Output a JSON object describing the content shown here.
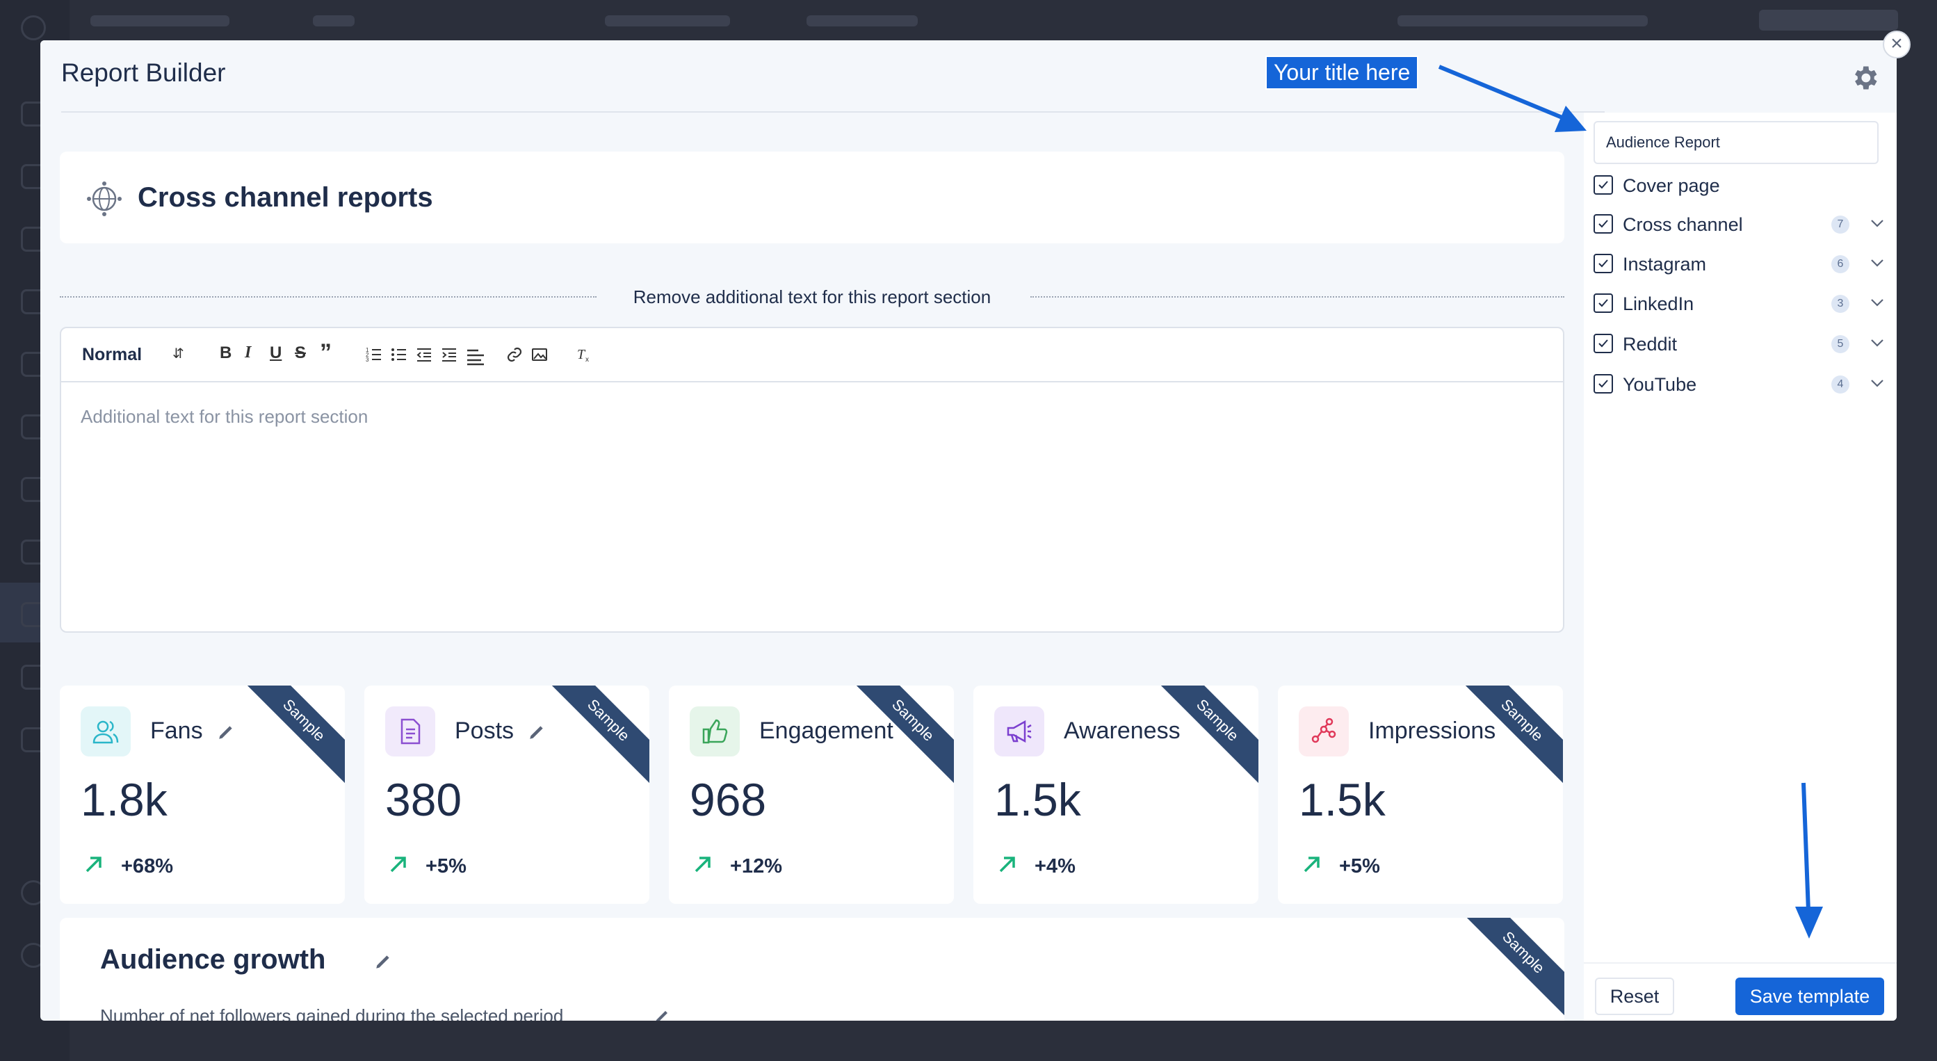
{
  "modal": {
    "title": "Report Builder",
    "close_label": "×"
  },
  "callout": {
    "text": "Your title here"
  },
  "section": {
    "title": "Cross channel reports",
    "divider_text": "Remove additional text for this report section"
  },
  "editor": {
    "format_select": "Normal",
    "toolbar": [
      "B",
      "I",
      "U",
      "S",
      "”"
    ],
    "placeholder": "Additional text for this report section"
  },
  "cards": [
    {
      "label": "Fans",
      "value": "1.8k",
      "change": "+68%",
      "ribbon": "Sample",
      "icon": "users-icon",
      "color": "#2bb6c9"
    },
    {
      "label": "Posts",
      "value": "380",
      "change": "+5%",
      "ribbon": "Sample",
      "icon": "document-icon",
      "color": "#8b4fd1"
    },
    {
      "label": "Engagement",
      "value": "968",
      "change": "+12%",
      "ribbon": "Sample",
      "icon": "thumbs-up-icon",
      "color": "#3aa55a"
    },
    {
      "label": "Awareness",
      "value": "1.5k",
      "change": "+4%",
      "ribbon": "Sample",
      "icon": "megaphone-icon",
      "color": "#7b3fcf"
    },
    {
      "label": "Impressions",
      "value": "1.5k",
      "change": "+5%",
      "ribbon": "Sample",
      "icon": "share-icon",
      "color": "#e0395a"
    }
  ],
  "growth": {
    "title": "Audience growth",
    "subtitle": "Number of net followers gained during the selected period",
    "ribbon": "Sample"
  },
  "sidebar": {
    "title_value": "Audience Report",
    "items": [
      {
        "label": "Cover page",
        "checked": true,
        "count": ""
      },
      {
        "label": "Cross channel",
        "checked": true,
        "count": "7"
      },
      {
        "label": "Instagram",
        "checked": true,
        "count": "6"
      },
      {
        "label": "LinkedIn",
        "checked": true,
        "count": "3"
      },
      {
        "label": "Reddit",
        "checked": true,
        "count": "5"
      },
      {
        "label": "YouTube",
        "checked": true,
        "count": "4"
      }
    ],
    "reset_label": "Reset",
    "save_label": "Save template"
  },
  "colors": {
    "accent": "#1565d8",
    "ribbon": "#2f4a72",
    "trend_up": "#19b37c"
  }
}
